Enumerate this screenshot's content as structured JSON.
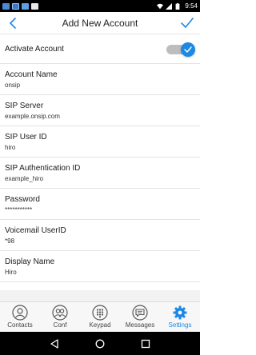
{
  "status_bar": {
    "time": "9:54"
  },
  "header": {
    "title": "Add New Account"
  },
  "form": {
    "activate": {
      "label": "Activate Account",
      "on": true
    },
    "fields": [
      {
        "label": "Account Name",
        "value": "onsip"
      },
      {
        "label": "SIP Server",
        "value": "example.onsip.com"
      },
      {
        "label": "SIP User ID",
        "value": "hiro"
      },
      {
        "label": "SIP Authentication ID",
        "value": "example_hiro"
      },
      {
        "label": "Password",
        "value": "***********"
      },
      {
        "label": "Voicemail UserID",
        "value": "*98"
      },
      {
        "label": "Display Name",
        "value": "Hiro"
      }
    ]
  },
  "bottom_nav": {
    "items": [
      {
        "label": "Contacts",
        "icon": "person-icon"
      },
      {
        "label": "Conf",
        "icon": "group-icon"
      },
      {
        "label": "Keypad",
        "icon": "keypad-icon"
      },
      {
        "label": "Messages",
        "icon": "chat-icon"
      },
      {
        "label": "Settings",
        "icon": "gear-icon",
        "active": true
      }
    ]
  },
  "colors": {
    "accent": "#1e88e5",
    "toggle_track": "#bdbdbd",
    "divider": "#e3e3e3"
  }
}
